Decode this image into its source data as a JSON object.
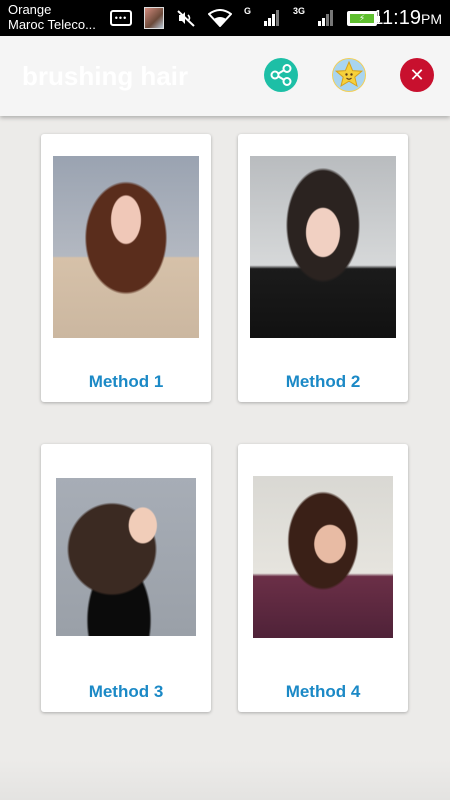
{
  "status_bar": {
    "carrier_line1": "Orange",
    "carrier_line2": "Maroc Teleco...",
    "network_g": "G",
    "network_3g": "3G",
    "time": "11:19",
    "ampm": "PM",
    "battery_color": "#5fbf2f"
  },
  "app_bar": {
    "title": "brushing hair",
    "actions": [
      {
        "name": "share",
        "icon": "share-icon",
        "color": "#1dbfa6"
      },
      {
        "name": "rate",
        "icon": "star-face-icon",
        "color": "#f2cf58"
      },
      {
        "name": "close",
        "icon": "close-icon",
        "color": "#c8102e",
        "glyph": "✕"
      }
    ]
  },
  "cards": [
    {
      "label": "Method 1",
      "image": "hairstyle-photo"
    },
    {
      "label": "Method 2",
      "image": "hairstyle-photo"
    },
    {
      "label": "Method 3",
      "image": "hairstyle-photo"
    },
    {
      "label": "Method 4",
      "image": "hairstyle-photo"
    }
  ],
  "colors": {
    "background": "#ecebe9",
    "card_label": "#1b89c6",
    "app_bar": "#f5f5f5"
  }
}
